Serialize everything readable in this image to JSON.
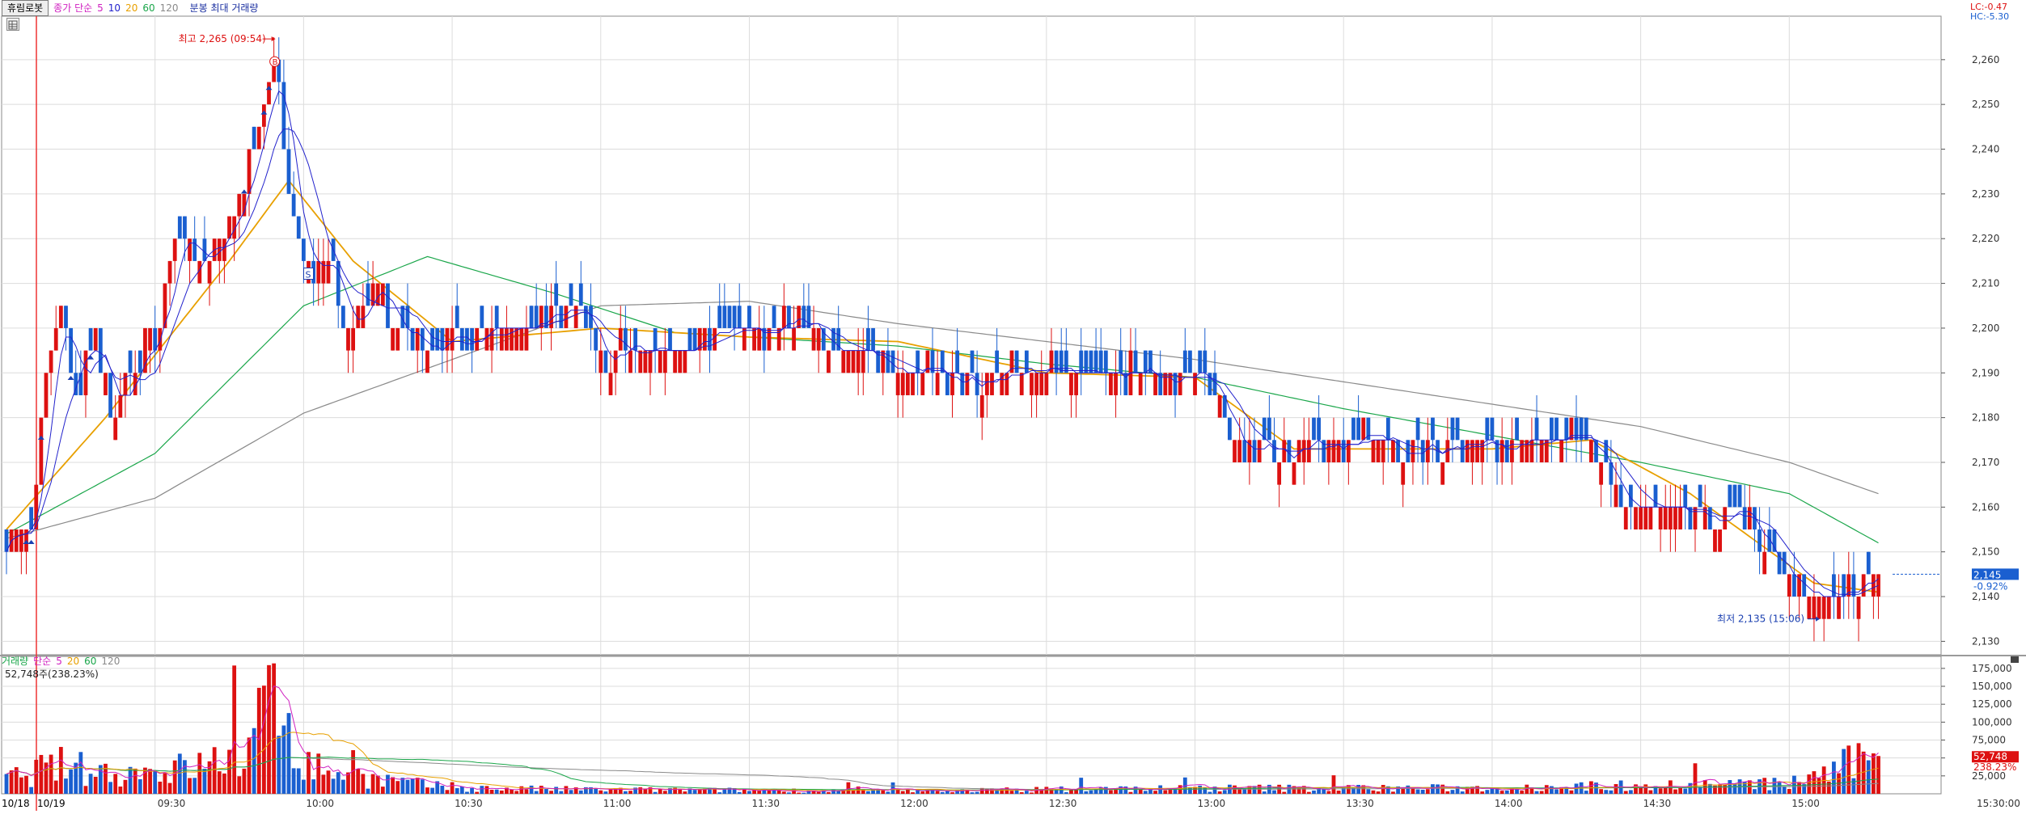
{
  "price_panel": {
    "stock_name": "휴림로봇",
    "ma_title": "종가 단순",
    "ma_periods": [
      "5",
      "10",
      "20",
      "60",
      "120"
    ],
    "ma_colors": [
      "#2222cc",
      "#2222cc",
      "#e8a000",
      "#1aa64a",
      "#8a8a8a"
    ],
    "indicator_label": "분봉 최대 거래량",
    "lc_label": "LC:-0.47",
    "hc_label": "HC:-5.30",
    "high_annotation": "최고 2,265 (09:54)",
    "low_annotation": "최저 2,135 (15:06)",
    "buy_marker": "B",
    "sell_marker": "S",
    "current_price_badge": "2,145",
    "current_change": "-0.92%",
    "y_ticks": [
      "2,130",
      "2,140",
      "2,150",
      "2,160",
      "2,170",
      "2,180",
      "2,190",
      "2,200",
      "2,210",
      "2,220",
      "2,230",
      "2,240",
      "2,250",
      "2,260"
    ]
  },
  "volume_panel": {
    "title": "거래량",
    "ma_title": "단순",
    "ma_periods": [
      "5",
      "20",
      "60",
      "120"
    ],
    "ma_colors": [
      "#d020c0",
      "#e8a000",
      "#1aa64a",
      "#8a8a8a"
    ],
    "current_value_label": "52,748주(238.23%)",
    "badge_value": "52,748",
    "badge_pct": "238.23%",
    "y_ticks": [
      "25,000",
      "50,000",
      "75,000",
      "100,000",
      "125,000",
      "150,000",
      "175,000"
    ]
  },
  "x_axis": {
    "labels": [
      "09:30",
      "10:00",
      "10:30",
      "11:00",
      "11:30",
      "12:00",
      "12:30",
      "13:00",
      "13:30",
      "14:00",
      "14:30",
      "15:00"
    ],
    "date_start_prev": "10/18",
    "date_start": "10/19",
    "end_label": "15:30:00"
  },
  "colors": {
    "up": "#dd1111",
    "down": "#1a5fd0",
    "grid": "#dcdcdc",
    "accent_badge": "#1a5fd0",
    "volume_badge": "#dd1111"
  },
  "chart_data": {
    "type": "candlestick",
    "bar_interval": "1 minute",
    "session": [
      "09:00",
      "15:30"
    ],
    "price_ylim": [
      2127,
      2269
    ],
    "volume_ylim": [
      0,
      185000
    ],
    "high": {
      "price": 2265,
      "time": "09:54"
    },
    "low": {
      "price": 2135,
      "time": "15:06"
    },
    "last_close": 2145,
    "change_pct": -0.92,
    "last_volume": 52748,
    "volume_ratio_pct": 238.23,
    "grid": true,
    "close_path_keypoints": [
      {
        "t": "09:00",
        "p": 2155
      },
      {
        "t": "09:05",
        "p": 2155
      },
      {
        "t": "09:08",
        "p": 2190
      },
      {
        "t": "09:11",
        "p": 2205
      },
      {
        "t": "09:14",
        "p": 2185
      },
      {
        "t": "09:18",
        "p": 2200
      },
      {
        "t": "09:21",
        "p": 2180
      },
      {
        "t": "09:25",
        "p": 2190
      },
      {
        "t": "09:30",
        "p": 2200
      },
      {
        "t": "09:34",
        "p": 2220
      },
      {
        "t": "09:38",
        "p": 2215
      },
      {
        "t": "09:44",
        "p": 2220
      },
      {
        "t": "09:50",
        "p": 2240
      },
      {
        "t": "09:54",
        "p": 2262
      },
      {
        "t": "09:57",
        "p": 2230
      },
      {
        "t": "10:00",
        "p": 2215
      },
      {
        "t": "10:05",
        "p": 2215
      },
      {
        "t": "10:09",
        "p": 2200
      },
      {
        "t": "10:14",
        "p": 2210
      },
      {
        "t": "10:20",
        "p": 2195
      },
      {
        "t": "10:22",
        "p": 2195
      },
      {
        "t": "10:27",
        "p": 2195
      },
      {
        "t": "10:35",
        "p": 2200
      },
      {
        "t": "10:45",
        "p": 2200
      },
      {
        "t": "10:55",
        "p": 2205
      },
      {
        "t": "11:00",
        "p": 2195
      },
      {
        "t": "11:15",
        "p": 2195
      },
      {
        "t": "11:25",
        "p": 2200
      },
      {
        "t": "11:40",
        "p": 2200
      },
      {
        "t": "11:55",
        "p": 2195
      },
      {
        "t": "12:00",
        "p": 2190
      },
      {
        "t": "12:15",
        "p": 2190
      },
      {
        "t": "12:30",
        "p": 2190
      },
      {
        "t": "12:45",
        "p": 2190
      },
      {
        "t": "12:58",
        "p": 2190
      },
      {
        "t": "13:03",
        "p": 2190
      },
      {
        "t": "13:08",
        "p": 2175
      },
      {
        "t": "13:15",
        "p": 2173
      },
      {
        "t": "13:30",
        "p": 2175
      },
      {
        "t": "13:40",
        "p": 2175
      },
      {
        "t": "13:50",
        "p": 2173
      },
      {
        "t": "14:00",
        "p": 2173
      },
      {
        "t": "14:10",
        "p": 2175
      },
      {
        "t": "14:15",
        "p": 2178
      },
      {
        "t": "14:22",
        "p": 2172
      },
      {
        "t": "14:28",
        "p": 2158
      },
      {
        "t": "14:40",
        "p": 2158
      },
      {
        "t": "14:50",
        "p": 2158
      },
      {
        "t": "14:55",
        "p": 2150
      },
      {
        "t": "15:02",
        "p": 2140
      },
      {
        "t": "15:06",
        "p": 2138
      },
      {
        "t": "15:12",
        "p": 2142
      },
      {
        "t": "15:18",
        "p": 2145
      }
    ],
    "ma_keypoints": {
      "ma20": [
        {
          "t": "09:00",
          "p": 2155
        },
        {
          "t": "09:20",
          "p": 2180
        },
        {
          "t": "09:45",
          "p": 2215
        },
        {
          "t": "09:57",
          "p": 2233
        },
        {
          "t": "10:10",
          "p": 2215
        },
        {
          "t": "10:30",
          "p": 2197
        },
        {
          "t": "11:00",
          "p": 2200
        },
        {
          "t": "11:30",
          "p": 2198
        },
        {
          "t": "12:00",
          "p": 2197
        },
        {
          "t": "12:30",
          "p": 2190
        },
        {
          "t": "13:00",
          "p": 2189
        },
        {
          "t": "13:20",
          "p": 2173
        },
        {
          "t": "14:00",
          "p": 2173
        },
        {
          "t": "14:20",
          "p": 2175
        },
        {
          "t": "14:40",
          "p": 2163
        },
        {
          "t": "15:05",
          "p": 2143
        },
        {
          "t": "15:18",
          "p": 2141
        }
      ],
      "ma60": [
        {
          "t": "09:00",
          "p": 2154
        },
        {
          "t": "09:30",
          "p": 2172
        },
        {
          "t": "10:00",
          "p": 2205
        },
        {
          "t": "10:25",
          "p": 2216
        },
        {
          "t": "10:50",
          "p": 2208
        },
        {
          "t": "11:15",
          "p": 2199
        },
        {
          "t": "12:00",
          "p": 2196
        },
        {
          "t": "12:30",
          "p": 2192
        },
        {
          "t": "13:00",
          "p": 2189
        },
        {
          "t": "13:30",
          "p": 2182
        },
        {
          "t": "14:00",
          "p": 2176
        },
        {
          "t": "14:30",
          "p": 2170
        },
        {
          "t": "15:00",
          "p": 2163
        },
        {
          "t": "15:18",
          "p": 2152
        }
      ],
      "ma120": [
        {
          "t": "09:00",
          "p": 2153
        },
        {
          "t": "09:30",
          "p": 2162
        },
        {
          "t": "10:00",
          "p": 2181
        },
        {
          "t": "10:30",
          "p": 2193
        },
        {
          "t": "11:00",
          "p": 2205
        },
        {
          "t": "11:30",
          "p": 2206
        },
        {
          "t": "12:00",
          "p": 2201
        },
        {
          "t": "12:30",
          "p": 2197
        },
        {
          "t": "13:00",
          "p": 2193
        },
        {
          "t": "13:30",
          "p": 2188
        },
        {
          "t": "14:00",
          "p": 2183
        },
        {
          "t": "14:30",
          "p": 2178
        },
        {
          "t": "15:00",
          "p": 2170
        },
        {
          "t": "15:18",
          "p": 2163
        }
      ]
    },
    "volume_profile": [
      {
        "t": "09:00",
        "v": 20000
      },
      {
        "t": "09:10",
        "v": 40000
      },
      {
        "t": "09:20",
        "v": 30000
      },
      {
        "t": "09:30",
        "v": 30000
      },
      {
        "t": "09:40",
        "v": 40000
      },
      {
        "t": "09:50",
        "v": 60000
      },
      {
        "t": "09:54",
        "v": 180000
      },
      {
        "t": "10:00",
        "v": 40000
      },
      {
        "t": "10:15",
        "v": 20000
      },
      {
        "t": "10:30",
        "v": 8000
      },
      {
        "t": "11:00",
        "v": 6000
      },
      {
        "t": "12:00",
        "v": 4000
      },
      {
        "t": "13:00",
        "v": 8000
      },
      {
        "t": "13:30",
        "v": 8000
      },
      {
        "t": "14:00",
        "v": 8000
      },
      {
        "t": "14:30",
        "v": 12000
      },
      {
        "t": "15:00",
        "v": 14000
      },
      {
        "t": "15:18",
        "v": 52748
      }
    ]
  }
}
